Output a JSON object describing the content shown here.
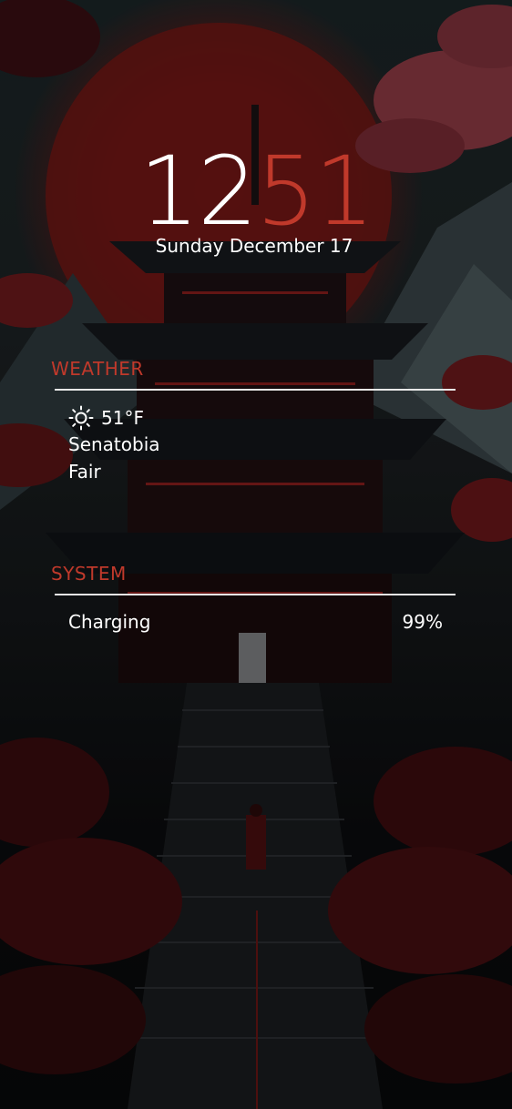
{
  "clock": {
    "hours": "12",
    "minutes": "51"
  },
  "date": "Sunday December 17",
  "weather": {
    "title": "WEATHER",
    "icon": "sun-icon",
    "temperature": "51°F",
    "city": "Senatobia",
    "condition": "Fair"
  },
  "system": {
    "title": "SYSTEM",
    "status": "Charging",
    "battery": "99%"
  },
  "colors": {
    "accent": "#c0392b",
    "text": "#ffffff"
  }
}
